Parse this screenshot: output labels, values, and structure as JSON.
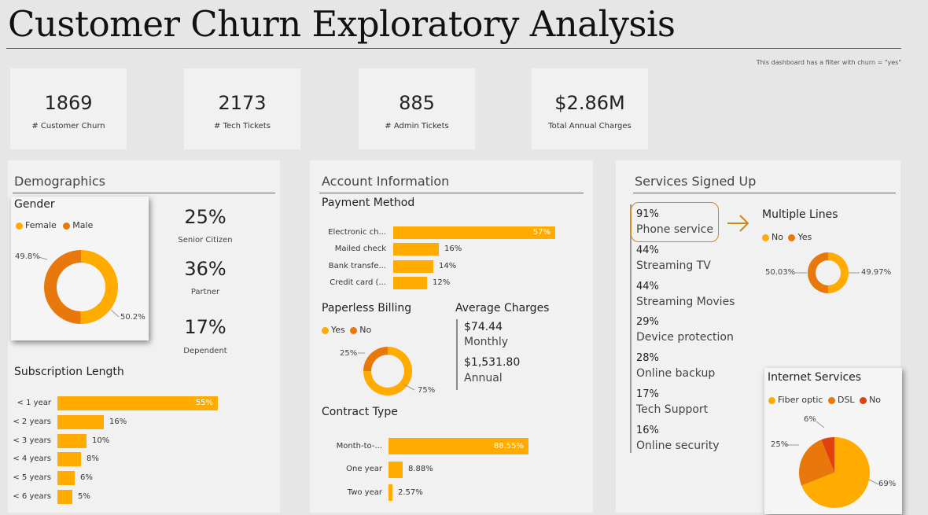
{
  "title": "Customer Churn Exploratory Analysis",
  "filter_note": "This dashboard has a filter with churn = \"yes\"",
  "kpis": [
    {
      "value": "1869",
      "label": "# Customer Churn"
    },
    {
      "value": "2173",
      "label": "# Tech Tickets"
    },
    {
      "value": "885",
      "label": "# Admin Tickets"
    },
    {
      "value": "$2.86M",
      "label": "Total Annual Charges"
    }
  ],
  "colors": {
    "orange": "#ffab00",
    "dark_orange": "#e8780b",
    "red": "#e0410d"
  },
  "demographics": {
    "title": "Demographics",
    "gender": {
      "title": "Gender",
      "legend": [
        "Female",
        "Male"
      ],
      "labels": [
        "49.8%",
        "50.2%"
      ]
    },
    "stats": [
      {
        "value": "25%",
        "label": "Senior Citizen"
      },
      {
        "value": "36%",
        "label": "Partner"
      },
      {
        "value": "17%",
        "label": "Dependent"
      }
    ],
    "subscription": {
      "title": "Subscription Length",
      "categories": [
        "< 1 year",
        "< 2 years",
        "< 3 years",
        "< 4 years",
        "< 5 years",
        "< 6 years"
      ],
      "labels": [
        "55%",
        "16%",
        "10%",
        "8%",
        "6%",
        "5%"
      ]
    }
  },
  "account": {
    "title": "Account Information",
    "payment": {
      "title": "Payment Method",
      "categories": [
        "Electronic ch...",
        "Mailed check",
        "Bank transfe...",
        "Credit card (..."
      ],
      "labels": [
        "57%",
        "16%",
        "14%",
        "12%"
      ]
    },
    "paperless": {
      "title": "Paperless Billing",
      "legend": [
        "Yes",
        "No"
      ],
      "labels": [
        "25%",
        "75%"
      ]
    },
    "avg_charges": {
      "title": "Average Charges",
      "monthly_value": "$74.44",
      "monthly_label": "Monthly",
      "annual_value": "$1,531.80",
      "annual_label": "Annual"
    },
    "contract": {
      "title": "Contract Type",
      "categories": [
        "Month-to-...",
        "One year",
        "Two year"
      ],
      "labels": [
        "88.55%",
        "8.88%",
        "2.57%"
      ]
    }
  },
  "services": {
    "title": "Services Signed Up",
    "items": [
      {
        "pct": "91%",
        "name": "Phone service"
      },
      {
        "pct": "44%",
        "name": "Streaming TV"
      },
      {
        "pct": "44%",
        "name": "Streaming Movies"
      },
      {
        "pct": "29%",
        "name": "Device protection"
      },
      {
        "pct": "28%",
        "name": "Online backup"
      },
      {
        "pct": "17%",
        "name": "Tech Support"
      },
      {
        "pct": "16%",
        "name": "Online security"
      }
    ],
    "multiple_lines": {
      "title": "Multiple Lines",
      "legend": [
        "No",
        "Yes"
      ],
      "labels": [
        "50.03%",
        "49.97%"
      ]
    },
    "internet": {
      "title": "Internet Services",
      "legend": [
        "Fiber optic",
        "DSL",
        "No"
      ],
      "labels": [
        "6%",
        "25%",
        "69%"
      ]
    }
  },
  "chart_data": [
    {
      "type": "pie",
      "title": "Gender",
      "labels": [
        "Female",
        "Male"
      ],
      "values": [
        50.2,
        49.8
      ]
    },
    {
      "type": "bar",
      "title": "Subscription Length",
      "categories": [
        "< 1 year",
        "< 2 years",
        "< 3 years",
        "< 4 years",
        "< 5 years",
        "< 6 years"
      ],
      "values": [
        55,
        16,
        10,
        8,
        6,
        5
      ]
    },
    {
      "type": "bar",
      "title": "Payment Method",
      "categories": [
        "Electronic ch...",
        "Mailed check",
        "Bank transfe...",
        "Credit card (..."
      ],
      "values": [
        57,
        16,
        14,
        12
      ]
    },
    {
      "type": "pie",
      "title": "Paperless Billing",
      "labels": [
        "Yes",
        "No"
      ],
      "values": [
        75,
        25
      ]
    },
    {
      "type": "bar",
      "title": "Contract Type",
      "categories": [
        "Month-to-...",
        "One year",
        "Two year"
      ],
      "values": [
        88.55,
        8.88,
        2.57
      ]
    },
    {
      "type": "pie",
      "title": "Multiple Lines",
      "labels": [
        "No",
        "Yes"
      ],
      "values": [
        50.03,
        49.97
      ]
    },
    {
      "type": "pie",
      "title": "Internet Services",
      "labels": [
        "Fiber optic",
        "DSL",
        "No"
      ],
      "values": [
        69,
        25,
        6
      ]
    }
  ]
}
